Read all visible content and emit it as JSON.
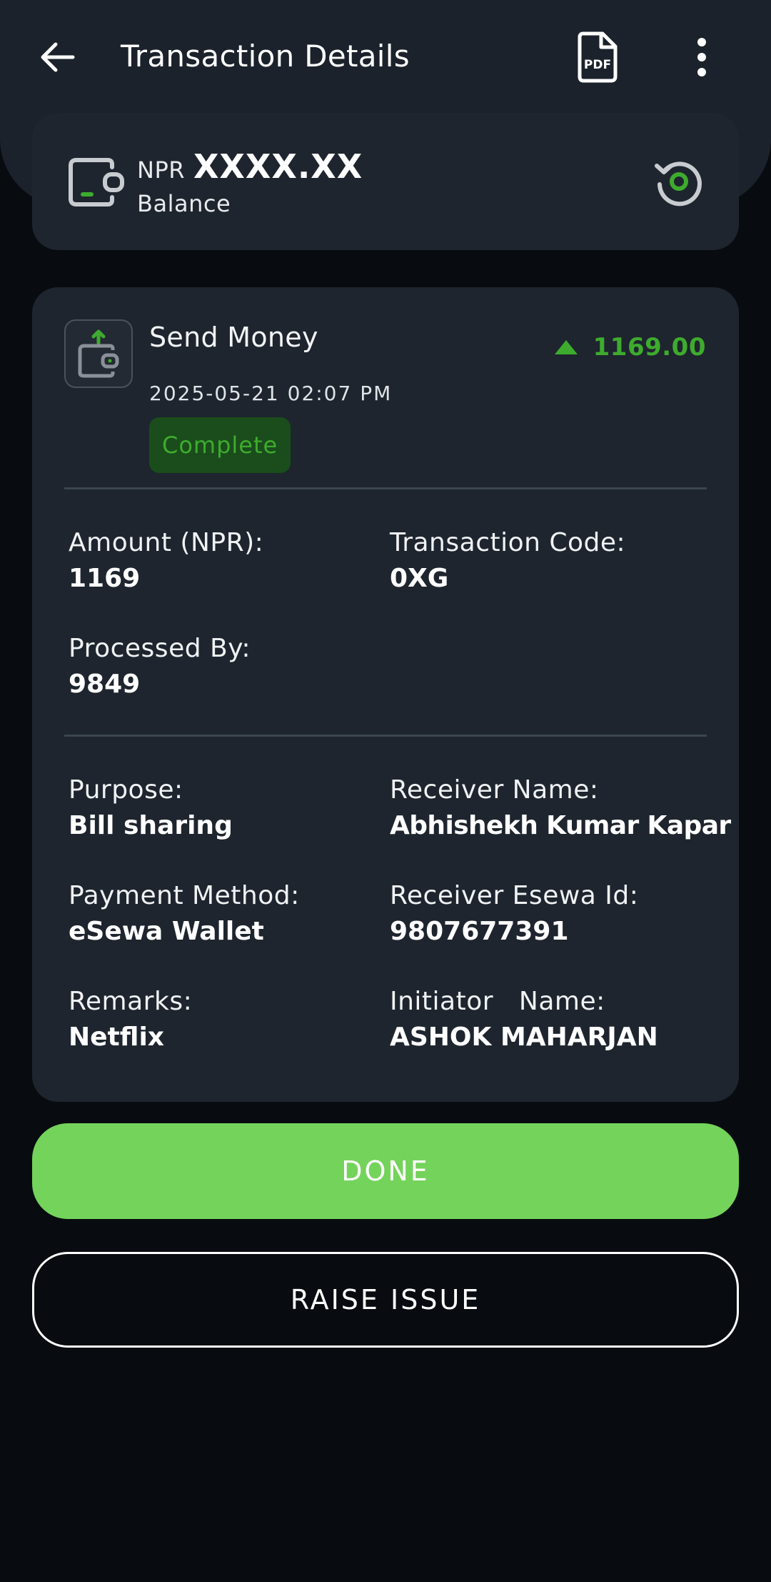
{
  "header": {
    "title": "Transaction Details",
    "back_icon": "arrow-left-icon",
    "pdf_icon": "pdf-file-icon",
    "pdf_icon_text": "PDF",
    "more_icon": "more-vertical-icon"
  },
  "balance": {
    "currency": "NPR",
    "amount": "XXXX.XX",
    "label": "Balance",
    "wallet_icon": "wallet-icon",
    "refresh_icon": "refresh-icon"
  },
  "transaction": {
    "type": "Send Money",
    "date": "2025-05-21 02:07 PM",
    "status": "Complete",
    "amount": "1169.00",
    "direction_icon": "arrow-up-icon",
    "fields_top": [
      {
        "label": "Amount (NPR):",
        "value": "1169"
      },
      {
        "label": "Transaction Code:",
        "value": "0XG"
      },
      {
        "label": "Processed By:",
        "value": "9849"
      }
    ],
    "fields_bottom": [
      {
        "label": "Purpose:",
        "value": "Bill sharing"
      },
      {
        "label": "Receiver Name:",
        "value": "Abhishekh Kumar Kapar"
      },
      {
        "label": "Payment Method:",
        "value": "eSewa Wallet"
      },
      {
        "label": "Receiver Esewa Id:",
        "value": "9807677391"
      },
      {
        "label": "Remarks:",
        "value": "Netflix"
      },
      {
        "label": "Initiator   Name:",
        "value": "ASHOK MAHARJAN"
      }
    ]
  },
  "actions": {
    "done_label": "DONE",
    "raise_issue_label": "RAISE ISSUE"
  },
  "colors": {
    "accent_green": "#74d35b",
    "success_green": "#3eab2e",
    "card_bg": "#1e252e",
    "page_bg": "#080c10"
  }
}
